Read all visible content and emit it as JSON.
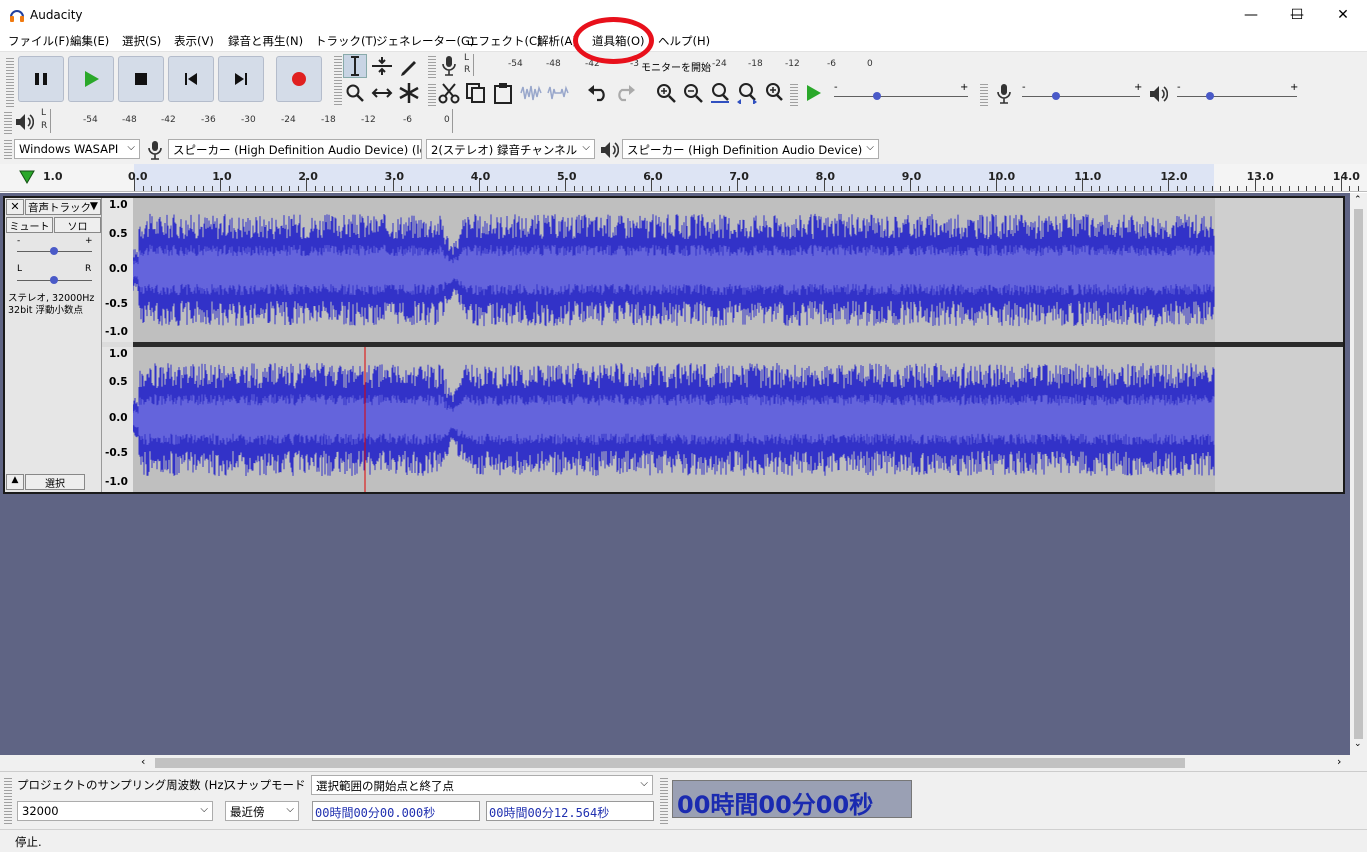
{
  "window": {
    "title": "Audacity",
    "minimize": "—",
    "maximize": "☐",
    "close": "✕"
  },
  "menu": [
    "ファイル(F)",
    "編集(E)",
    "選択(S)",
    "表示(V)",
    "録音と再生(N)",
    "トラック(T)",
    "ジェネレーター(G)",
    "エフェクト(C)",
    "解析(A)",
    "道具箱(O)",
    "ヘルプ(H)"
  ],
  "record_meter": {
    "lr": [
      "L",
      "R"
    ],
    "scale": [
      "-54",
      "-48",
      "-42",
      "-3",
      "モニターを開始",
      "-24",
      "-18",
      "-12",
      "-6",
      "0"
    ]
  },
  "play_meter": {
    "lr": [
      "L",
      "R"
    ],
    "scale": [
      "-54",
      "-48",
      "-42",
      "-36",
      "-30",
      "-24",
      "-18",
      "-12",
      "-6",
      "0"
    ]
  },
  "slider_signs": {
    "minus": "-",
    "plus": "+"
  },
  "device": {
    "host": "Windows WASAPI",
    "recording_device": "スピーカー (High Definition Audio Device) (loo",
    "channels": "2(ステレオ) 録音チャンネル",
    "playback_device": "スピーカー (High Definition Audio Device)"
  },
  "ruler": {
    "left_label": "1.0",
    "ticks": [
      "0.0",
      "1.0",
      "2.0",
      "3.0",
      "4.0",
      "5.0",
      "6.0",
      "7.0",
      "8.0",
      "9.0",
      "10.0",
      "11.0",
      "12.0",
      "13.0",
      "14.0"
    ]
  },
  "track": {
    "name": "音声トラック",
    "mute": "ミュート",
    "solo": "ソロ",
    "gain_minus": "-",
    "gain_plus": "+",
    "pan_left": "L",
    "pan_right": "R",
    "info_line1": "ステレオ, 32000Hz",
    "info_line2": "32bit 浮動小数点",
    "select": "選択",
    "scale_top": [
      "1.0",
      "0.5",
      "0.0",
      "-0.5",
      "-1.0"
    ],
    "scale_bottom": [
      "1.0",
      "0.5",
      "0.0",
      "-0.5",
      "-1.0"
    ],
    "colors": {
      "wave": "#3232c8",
      "rms": "#6464dc",
      "cursor": "#e00000"
    }
  },
  "selection_toolbar": {
    "rate_label": "プロジェクトのサンプリング周波数 (Hz)",
    "rate_value": "32000",
    "snap_label": "スナップモード",
    "snap_value": "最近傍",
    "range_mode": "選択範囲の開始点と終了点",
    "start_time": "00時間00分00.000秒",
    "end_time": "00時間00分12.564秒",
    "audio_position": "00時間00分00秒"
  },
  "status": "停止."
}
